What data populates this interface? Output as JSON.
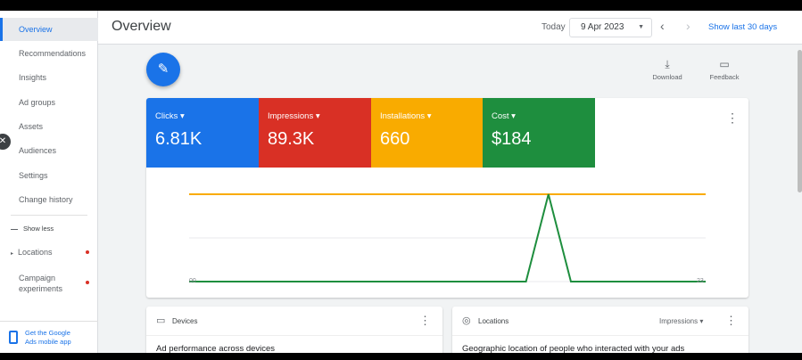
{
  "sidebar": {
    "items": [
      {
        "label": "Overview"
      },
      {
        "label": "Recommendations"
      },
      {
        "label": "Insights"
      },
      {
        "label": "Ad groups"
      },
      {
        "label": "Assets"
      },
      {
        "label": "Audiences"
      },
      {
        "label": "Settings"
      },
      {
        "label": "Change history"
      }
    ],
    "show_less": "Show less",
    "locations": "Locations",
    "campaign_experiments": "Campaign\nexperiments",
    "get_app": "Get the Google\nAds mobile app"
  },
  "header": {
    "title": "Overview",
    "today_label": "Today",
    "date": "9 Apr 2023",
    "show_last": "Show last 30 days"
  },
  "toolbar": {
    "download_label": "Download",
    "feedback_label": "Feedback"
  },
  "metrics": [
    {
      "label": "Clicks",
      "value": "6.81K",
      "color": "#1a73e8"
    },
    {
      "label": "Impressions",
      "value": "89.3K",
      "color": "#d93025"
    },
    {
      "label": "Installations",
      "value": "660",
      "color": "#f9ab00"
    },
    {
      "label": "Cost",
      "value": "$184",
      "color": "#1e8e3e"
    }
  ],
  "chart_data": {
    "type": "line",
    "x": [
      0,
      15,
      16,
      17,
      23
    ],
    "xticks": [
      "00",
      "23"
    ],
    "series": [
      {
        "color": "#f9ab00",
        "values": [
          100,
          100,
          100,
          100,
          100
        ]
      },
      {
        "color": "#1e8e3e",
        "values": [
          0,
          0,
          100,
          0,
          0
        ]
      }
    ],
    "ylim": [
      0,
      100
    ],
    "grid": true
  },
  "cards": {
    "devices": {
      "title": "Devices",
      "desc": "Ad performance across devices"
    },
    "locations": {
      "title": "Locations",
      "metric": "Impressions",
      "desc": "Geographic location of people who interacted with your ads"
    }
  },
  "colors": {
    "accent": "#1a73e8"
  }
}
